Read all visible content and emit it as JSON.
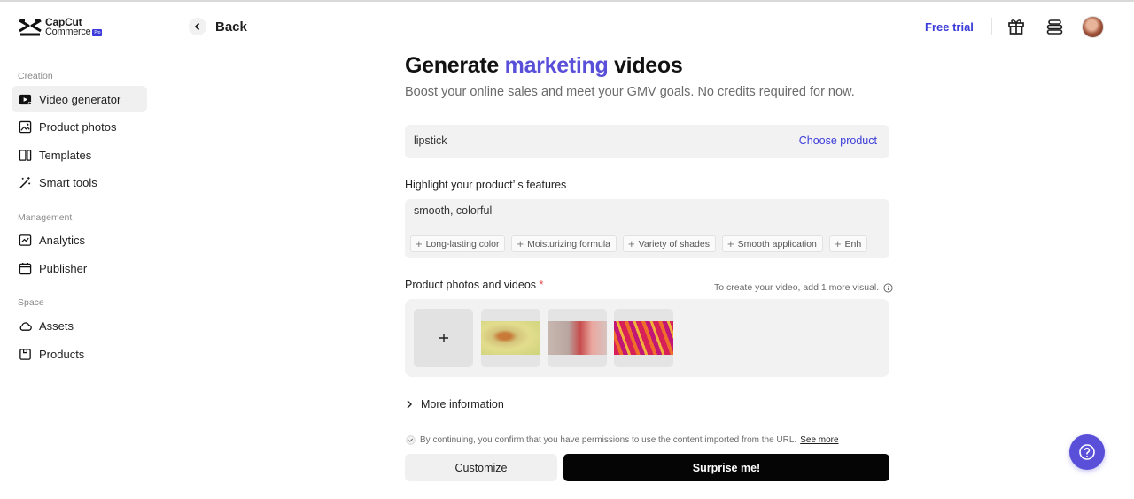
{
  "brand": {
    "line1": "CapCut",
    "line2": "Commerce",
    "badge": "Pro"
  },
  "sidebar": {
    "sections": [
      {
        "label": "Creation",
        "items": [
          {
            "label": "Video generator",
            "icon": "video-generator-icon",
            "active": true
          },
          {
            "label": "Product photos",
            "icon": "product-photos-icon"
          },
          {
            "label": "Templates",
            "icon": "templates-icon"
          },
          {
            "label": "Smart tools",
            "icon": "magic-wand-icon"
          }
        ]
      },
      {
        "label": "Management",
        "items": [
          {
            "label": "Analytics",
            "icon": "analytics-icon"
          },
          {
            "label": "Publisher",
            "icon": "calendar-icon"
          }
        ]
      },
      {
        "label": "Space",
        "items": [
          {
            "label": "Assets",
            "icon": "cloud-icon"
          },
          {
            "label": "Products",
            "icon": "box-icon"
          }
        ]
      }
    ]
  },
  "header": {
    "back_label": "Back",
    "free_trial": "Free trial"
  },
  "main": {
    "title_pre": "Generate ",
    "title_accent": "marketing",
    "title_post": " videos",
    "subtitle": "Boost your online sales and meet your GMV goals. No credits required for now.",
    "product": {
      "value": "lipstick",
      "action": "Choose product"
    },
    "features": {
      "label": "Highlight your product’ s features",
      "value": "smooth, colorful",
      "chips": [
        "Long-lasting color",
        "Moisturizing formula",
        "Variety of shades",
        "Smooth application",
        "Enh"
      ]
    },
    "media": {
      "label": "Product photos and videos",
      "required_mark": "*",
      "hint": "To create your video, add 1 more visual."
    },
    "more_info": "More information",
    "consent": {
      "text": "By continuing, you confirm that you have permissions to use the content imported from the URL.",
      "link": "See more"
    },
    "buttons": {
      "customize": "Customize",
      "surprise": "Surprise me!"
    }
  },
  "colors": {
    "accent": "#5a4fd8",
    "link": "#3b3bd9",
    "primary_button": "#050505"
  }
}
